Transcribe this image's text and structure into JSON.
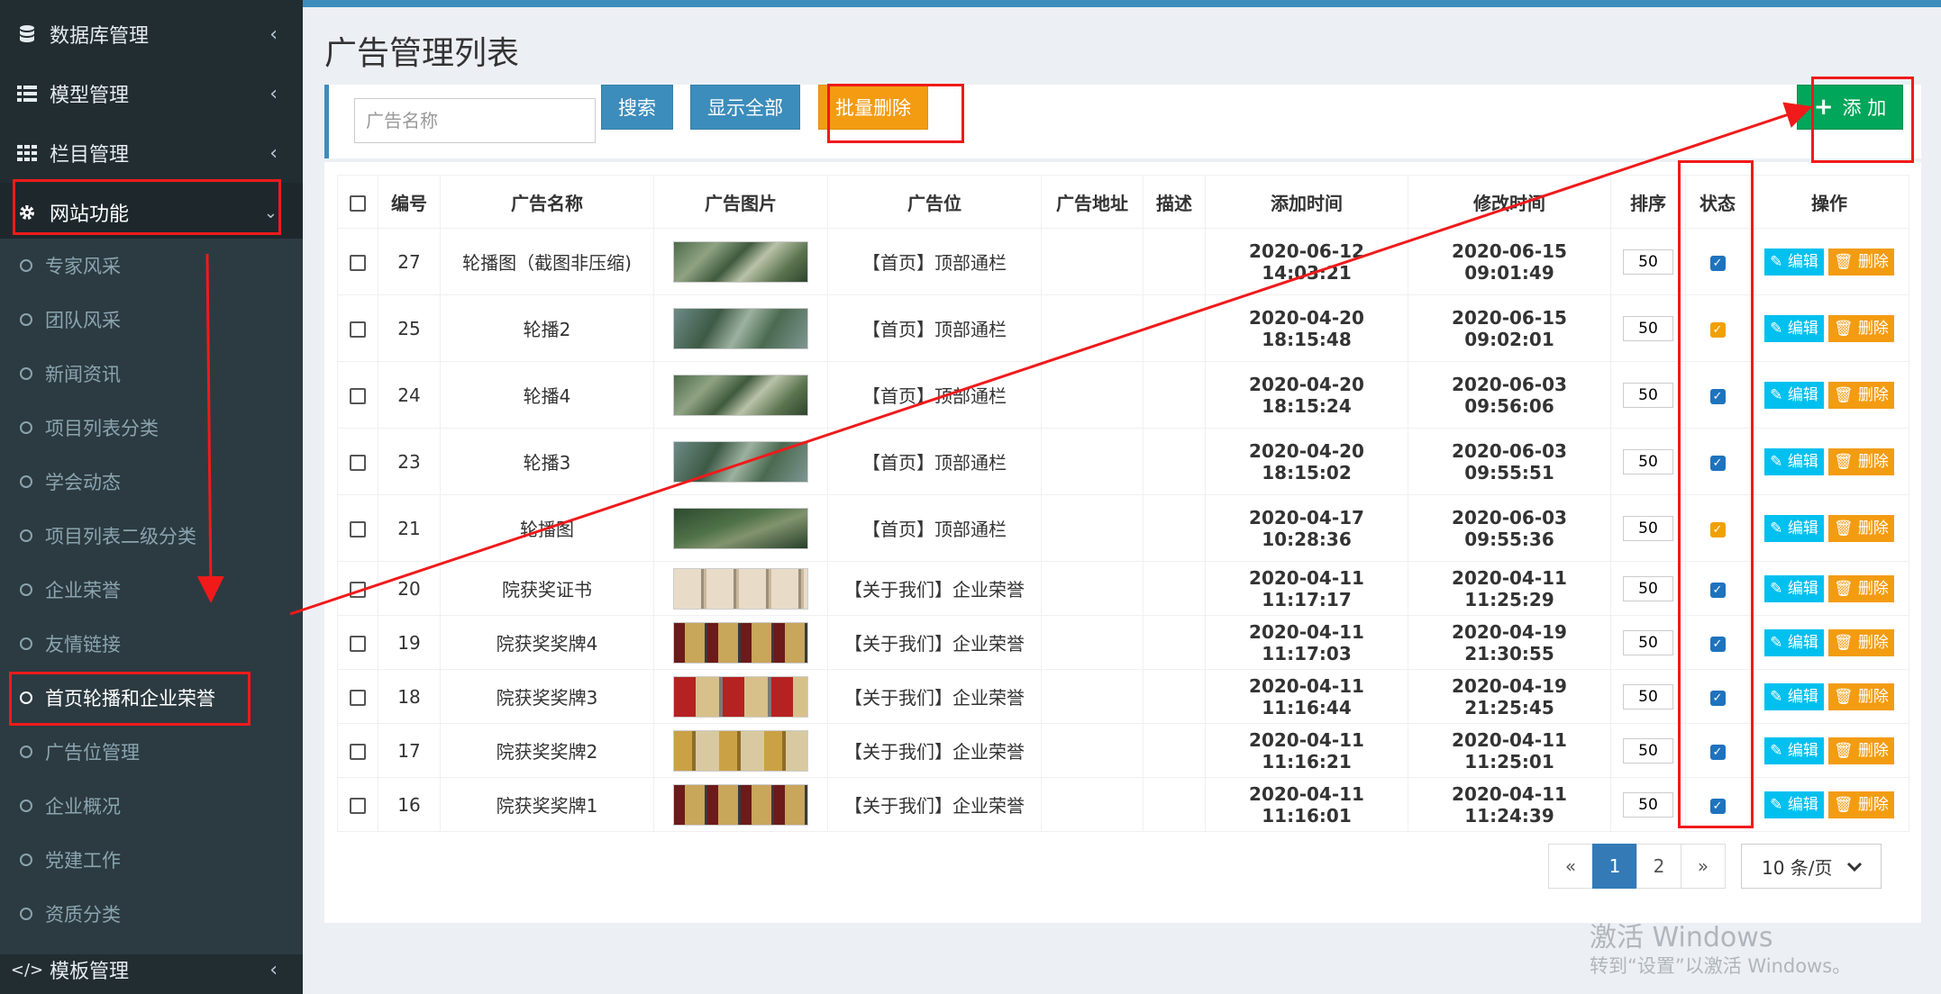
{
  "sidebar": {
    "menus": [
      {
        "label": "数据库管理",
        "icon": "database-icon"
      },
      {
        "label": "模型管理",
        "icon": "table-list-icon"
      },
      {
        "label": "栏目管理",
        "icon": "grid-icon"
      },
      {
        "label": "网站功能",
        "icon": "gear-icon"
      }
    ],
    "submenu": [
      "专家风采",
      "团队风采",
      "新闻资讯",
      "项目列表分类",
      "学会动态",
      "项目列表二级分类",
      "企业荣誉",
      "友情链接",
      "首页轮播和企业荣誉",
      "广告位管理",
      "企业概况",
      "党建工作",
      "资质分类"
    ],
    "active_submenu_index": 8,
    "bottom_menu": {
      "label": "模板管理",
      "icon": "code-icon"
    }
  },
  "page": {
    "title": "广告管理列表"
  },
  "toolbar": {
    "search_placeholder": "广告名称",
    "search_label": "搜索",
    "show_all_label": "显示全部",
    "batch_delete_label": "批量删除",
    "add_label": "添 加"
  },
  "table": {
    "headers": [
      "编号",
      "广告名称",
      "广告图片",
      "广告位",
      "广告地址",
      "描述",
      "添加时间",
      "修改时间",
      "排序",
      "状态",
      "操作"
    ],
    "rows": [
      {
        "id": "27",
        "name": "轮播图（截图非压缩)",
        "position": "【首页】顶部通栏",
        "address": "",
        "desc": "",
        "added": "2020-06-12 14:03:21",
        "modified": "2020-06-15 09:01:49",
        "sort": "50",
        "status": "blue",
        "thumb": "aerial"
      },
      {
        "id": "25",
        "name": "轮播2",
        "position": "【首页】顶部通栏",
        "address": "",
        "desc": "",
        "added": "2020-04-20 18:15:48",
        "modified": "2020-06-15 09:02:01",
        "sort": "50",
        "status": "orange",
        "thumb": "aerial2"
      },
      {
        "id": "24",
        "name": "轮播4",
        "position": "【首页】顶部通栏",
        "address": "",
        "desc": "",
        "added": "2020-04-20 18:15:24",
        "modified": "2020-06-03 09:56:06",
        "sort": "50",
        "status": "blue",
        "thumb": "aerial"
      },
      {
        "id": "23",
        "name": "轮播3",
        "position": "【首页】顶部通栏",
        "address": "",
        "desc": "",
        "added": "2020-04-20 18:15:02",
        "modified": "2020-06-03 09:55:51",
        "sort": "50",
        "status": "blue",
        "thumb": "aerial2"
      },
      {
        "id": "21",
        "name": "轮播图",
        "position": "【首页】顶部通栏",
        "address": "",
        "desc": "",
        "added": "2020-04-17 10:28:36",
        "modified": "2020-06-03 09:55:36",
        "sort": "50",
        "status": "orange",
        "thumb": "aerial3"
      },
      {
        "id": "20",
        "name": "院获奖证书",
        "position": "【关于我们】企业荣誉",
        "address": "",
        "desc": "",
        "added": "2020-04-11 11:17:17",
        "modified": "2020-04-11 11:25:29",
        "sort": "50",
        "status": "blue",
        "thumb": "cert"
      },
      {
        "id": "19",
        "name": "院获奖奖牌4",
        "position": "【关于我们】企业荣誉",
        "address": "",
        "desc": "",
        "added": "2020-04-11 11:17:03",
        "modified": "2020-04-19 21:30:55",
        "sort": "50",
        "status": "blue",
        "thumb": "plaque"
      },
      {
        "id": "18",
        "name": "院获奖奖牌3",
        "position": "【关于我们】企业荣誉",
        "address": "",
        "desc": "",
        "added": "2020-04-11 11:16:44",
        "modified": "2020-04-19 21:25:45",
        "sort": "50",
        "status": "blue",
        "thumb": "plaque2"
      },
      {
        "id": "17",
        "name": "院获奖奖牌2",
        "position": "【关于我们】企业荣誉",
        "address": "",
        "desc": "",
        "added": "2020-04-11 11:16:21",
        "modified": "2020-04-11 11:25:01",
        "sort": "50",
        "status": "blue",
        "thumb": "plaque3"
      },
      {
        "id": "16",
        "name": "院获奖奖牌1",
        "position": "【关于我们】企业荣誉",
        "address": "",
        "desc": "",
        "added": "2020-04-11 11:16:01",
        "modified": "2020-04-11 11:24:39",
        "sort": "50",
        "status": "blue",
        "thumb": "plaque"
      }
    ],
    "edit_label": "编辑",
    "delete_label": "删除"
  },
  "pagination": {
    "prev": "«",
    "pages": [
      "1",
      "2"
    ],
    "current": "1",
    "next": "»",
    "per_page": "10 条/页"
  },
  "watermark": {
    "line1": "激活 Windows",
    "line2": "转到“设置”以激活 Windows。"
  },
  "colors": {
    "sidebar": "#222d32",
    "submenu": "#2c3b41",
    "primary": "#3c8dbc",
    "orange": "#f39c12",
    "green": "#00a65a",
    "annotation": "#f01a1a"
  }
}
